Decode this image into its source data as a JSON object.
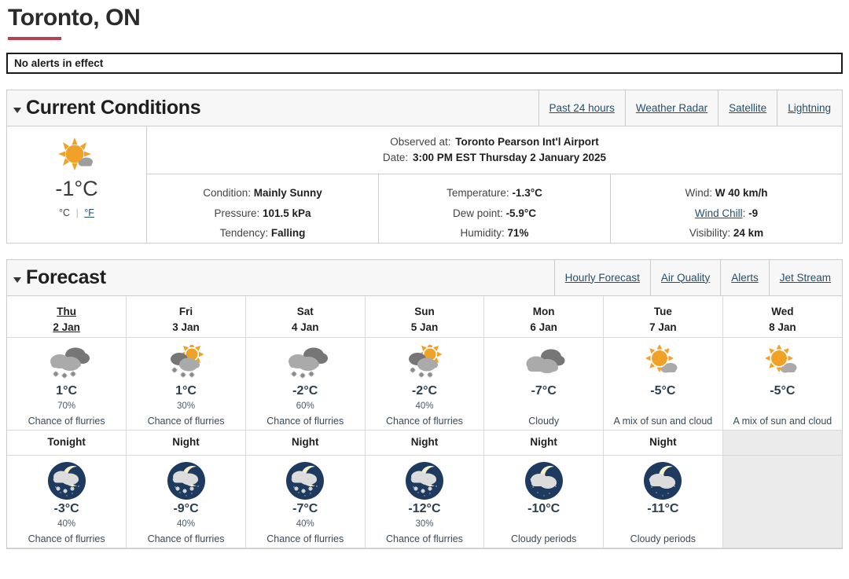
{
  "page": {
    "title": "Toronto, ON",
    "accent_color": "#b8424f"
  },
  "alert": {
    "text": "No alerts in effect"
  },
  "current_conditions": {
    "heading": "Current Conditions",
    "caret_icon": "chevron-down-icon",
    "links": [
      {
        "label": "Past 24 hours"
      },
      {
        "label": "Weather Radar"
      },
      {
        "label": "Satellite"
      },
      {
        "label": "Lightning"
      }
    ],
    "icon": "sun-behind-small-cloud-icon",
    "temperature": "-1°C",
    "units": {
      "celsius": "°C",
      "separator": "|",
      "fahrenheit": "°F"
    },
    "observed": {
      "observed_at_label": "Observed at:",
      "observed_at_value": "Toronto Pearson Int'l Airport",
      "date_label": "Date:",
      "date_value": "3:00 PM EST Thursday 2 January 2025"
    },
    "column_left": [
      {
        "label": "Condition:",
        "value": "Mainly Sunny"
      },
      {
        "label": "Pressure:",
        "value": "101.5 kPa"
      },
      {
        "label": "Tendency:",
        "value": "Falling"
      }
    ],
    "column_middle": [
      {
        "label": "Temperature:",
        "value": "-1.3°C"
      },
      {
        "label": "Dew point:",
        "value": "-5.9°C"
      },
      {
        "label": "Humidity:",
        "value": "71%"
      }
    ],
    "column_right": [
      {
        "label": "Wind:",
        "value": "W 40 km/h",
        "link": false
      },
      {
        "label": "Wind Chill",
        "value": "-9",
        "link": true
      },
      {
        "label": "Visibility:",
        "value": "24 km",
        "link": false
      }
    ]
  },
  "forecast": {
    "heading": "Forecast",
    "caret_icon": "chevron-down-icon",
    "links": [
      {
        "label": "Hourly Forecast"
      },
      {
        "label": "Air Quality"
      },
      {
        "label": "Alerts"
      },
      {
        "label": "Jet Stream"
      }
    ],
    "days": [
      {
        "weekday": "Thu",
        "date": "2 Jan",
        "is_link": true,
        "day": {
          "icon": "cloudy-flurries-icon",
          "temp": "1°C",
          "pop": "70%",
          "summary": "Chance of flurries"
        },
        "night_label": "Tonight",
        "night": {
          "icon": "night-cloud-flurries-icon",
          "temp": "-3°C",
          "pop": "40%",
          "summary": "Chance of flurries"
        }
      },
      {
        "weekday": "Fri",
        "date": "3 Jan",
        "is_link": false,
        "day": {
          "icon": "sun-cloud-flurries-icon",
          "temp": "1°C",
          "pop": "30%",
          "summary": "Chance of flurries"
        },
        "night_label": "Night",
        "night": {
          "icon": "night-cloud-flurries-icon",
          "temp": "-9°C",
          "pop": "40%",
          "summary": "Chance of flurries"
        }
      },
      {
        "weekday": "Sat",
        "date": "4 Jan",
        "is_link": false,
        "day": {
          "icon": "cloudy-flurries-icon",
          "temp": "-2°C",
          "pop": "60%",
          "summary": "Chance of flurries"
        },
        "night_label": "Night",
        "night": {
          "icon": "night-cloud-flurries-icon",
          "temp": "-7°C",
          "pop": "40%",
          "summary": "Chance of flurries"
        }
      },
      {
        "weekday": "Sun",
        "date": "5 Jan",
        "is_link": false,
        "day": {
          "icon": "sun-cloud-flurries-icon",
          "temp": "-2°C",
          "pop": "40%",
          "summary": "Chance of flurries"
        },
        "night_label": "Night",
        "night": {
          "icon": "night-cloud-flurries-icon",
          "temp": "-12°C",
          "pop": "30%",
          "summary": "Chance of flurries"
        }
      },
      {
        "weekday": "Mon",
        "date": "6 Jan",
        "is_link": false,
        "day": {
          "icon": "cloudy-icon",
          "temp": "-7°C",
          "pop": "",
          "summary": "Cloudy"
        },
        "night_label": "Night",
        "night": {
          "icon": "night-cloudy-icon",
          "temp": "-10°C",
          "pop": "",
          "summary": "Cloudy periods"
        }
      },
      {
        "weekday": "Tue",
        "date": "7 Jan",
        "is_link": false,
        "day": {
          "icon": "sun-cloud-icon",
          "temp": "-5°C",
          "pop": "",
          "summary": "A mix of sun and cloud"
        },
        "night_label": "Night",
        "night": {
          "icon": "night-cloudy-icon",
          "temp": "-11°C",
          "pop": "",
          "summary": "Cloudy periods"
        }
      },
      {
        "weekday": "Wed",
        "date": "8 Jan",
        "is_link": false,
        "day": {
          "icon": "sun-cloud-icon",
          "temp": "-5°C",
          "pop": "",
          "summary": "A mix of sun and cloud"
        },
        "night_label": "",
        "night": null
      }
    ]
  },
  "colors": {
    "accent_red": "#b8424f",
    "link_blue": "#22506e",
    "sun_orange": "#f0a128",
    "cloud_light": "#aaaaaa",
    "cloud_dark": "#767676",
    "night_circle": "#1f3a5f",
    "temp_navy": "#2b3e50"
  }
}
